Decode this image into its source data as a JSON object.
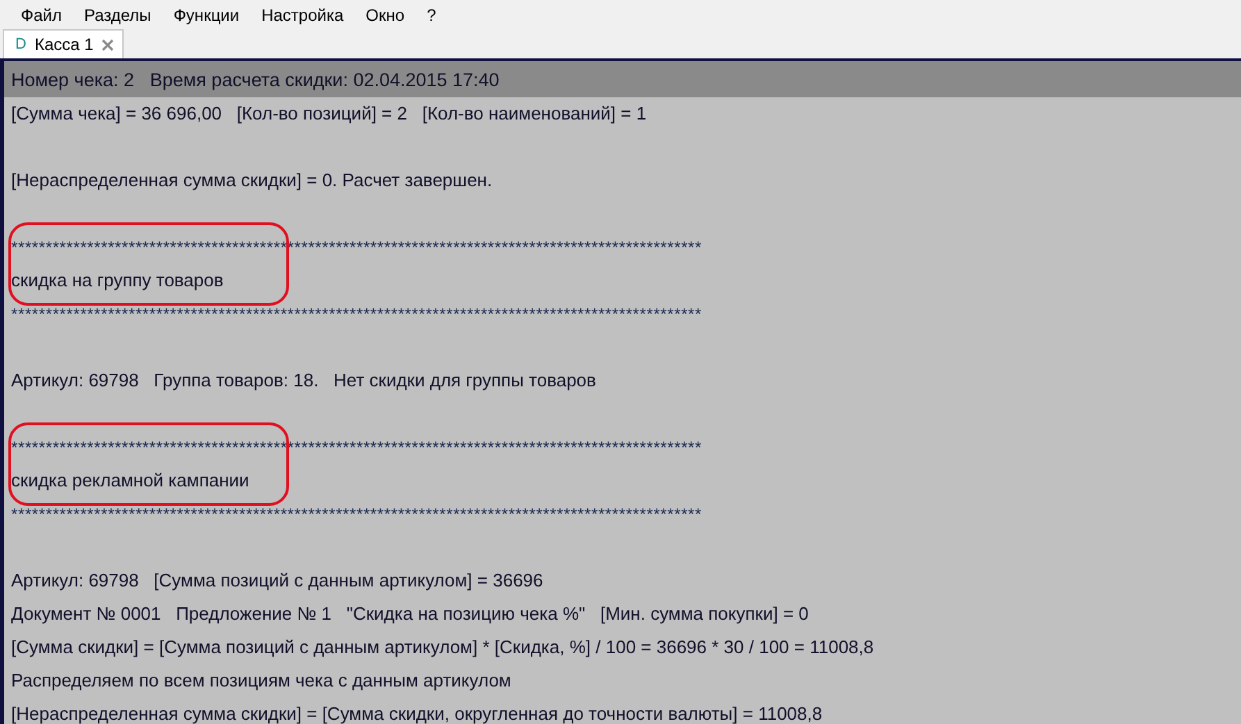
{
  "menu": [
    "Файл",
    "Разделы",
    "Функции",
    "Настройка",
    "Окно",
    "?"
  ],
  "tabs": [
    {
      "icon": "D",
      "label": "Касса 1",
      "selected": true
    }
  ],
  "header": "Номер чека: 2   Время расчета скидки: 02.04.2015 17:40",
  "lines": [
    {
      "kind": "text",
      "text": "[Сумма чека] = 36 696,00   [Кол-во позиций] = 2   [Кол-во наименований] = 1"
    },
    {
      "kind": "blank"
    },
    {
      "kind": "text",
      "text": "[Нераспределенная сумма скидки] = 0. Расчет завершен."
    },
    {
      "kind": "blank"
    },
    {
      "kind": "section",
      "stars": "****************************************************************************************************",
      "title": "скидка на группу товаров",
      "circled": true
    },
    {
      "kind": "blank"
    },
    {
      "kind": "text",
      "text": "Артикул: 69798   Группа товаров: 18.   Нет скидки для группы товаров"
    },
    {
      "kind": "blank"
    },
    {
      "kind": "section",
      "stars": "****************************************************************************************************",
      "title": "скидка рекламной кампании",
      "circled": true
    },
    {
      "kind": "blank"
    },
    {
      "kind": "text",
      "text": "Артикул: 69798   [Сумма позиций с данным артикулом] = 36696"
    },
    {
      "kind": "text",
      "text": "Документ № 0001   Предложение № 1   \"Скидка на позицию чека %\"   [Мин. сумма покупки] = 0"
    },
    {
      "kind": "text",
      "text": "[Сумма скидки] = [Сумма позиций с данным артикулом] * [Скидка, %] / 100 = 36696 * 30 / 100 = 11008,8"
    },
    {
      "kind": "text",
      "text": "Распределяем по всем позициям чека с данным артикулом"
    },
    {
      "kind": "text",
      "text": "[Нераспределенная сумма скидки] = [Сумма скидки, округленная до точности валюты] = 11008,8"
    }
  ]
}
